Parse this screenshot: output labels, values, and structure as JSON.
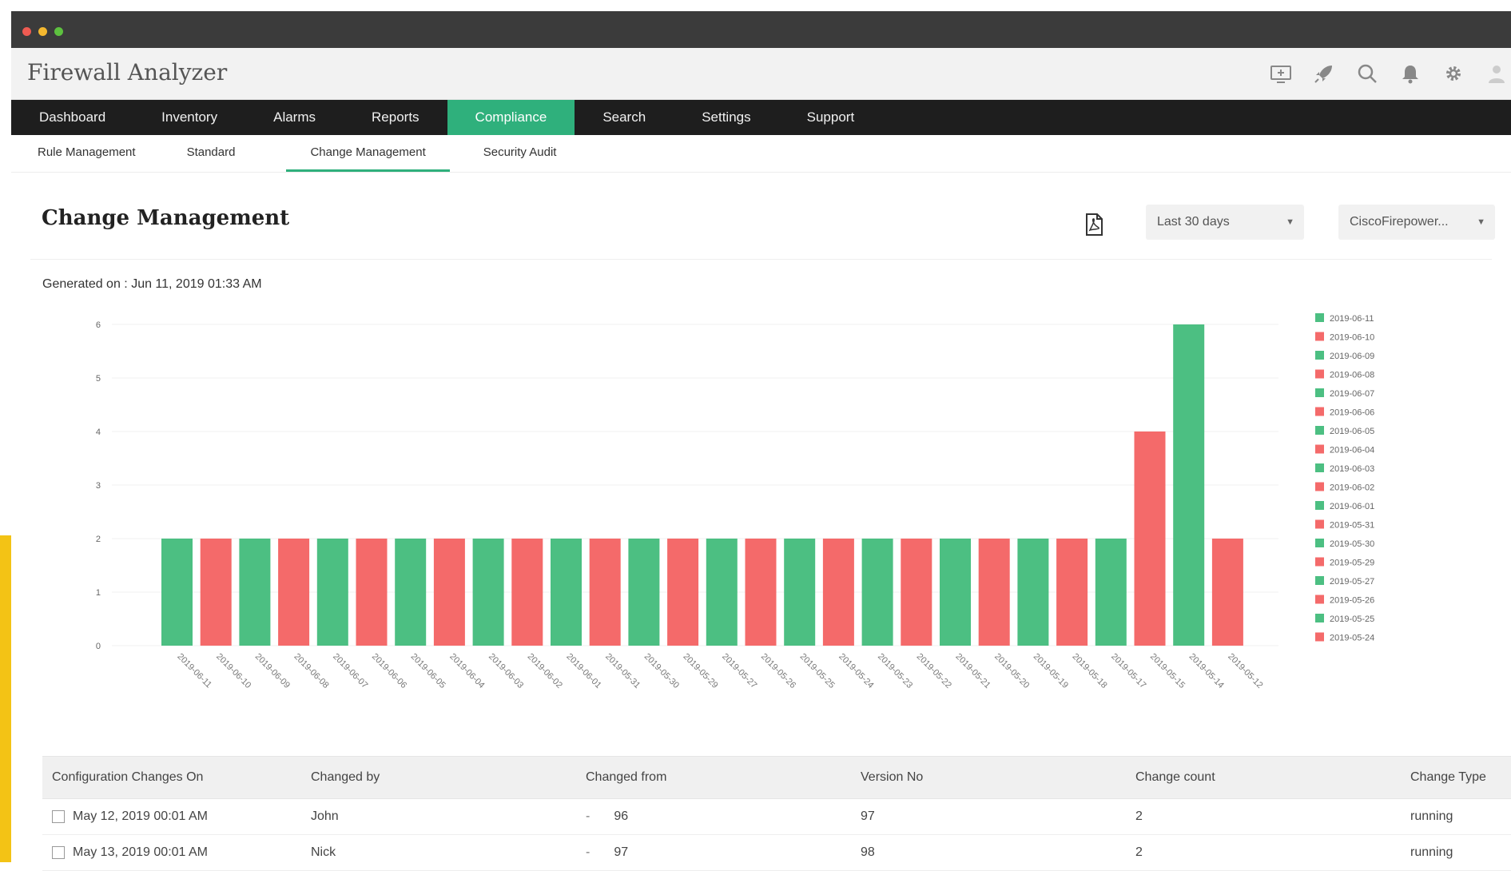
{
  "app": {
    "title": "Firewall Analyzer"
  },
  "header_icons": [
    "monitor-icon",
    "rocket-icon",
    "search-icon",
    "bell-icon",
    "gear-icon",
    "user-icon"
  ],
  "main_nav": [
    {
      "label": "Dashboard",
      "active": false
    },
    {
      "label": "Inventory",
      "active": false
    },
    {
      "label": "Alarms",
      "active": false
    },
    {
      "label": "Reports",
      "active": false
    },
    {
      "label": "Compliance",
      "active": true
    },
    {
      "label": "Search",
      "active": false
    },
    {
      "label": "Settings",
      "active": false
    },
    {
      "label": "Support",
      "active": false
    }
  ],
  "sub_nav": [
    {
      "label": "Rule Management",
      "active": false
    },
    {
      "label": "Standard",
      "active": false
    },
    {
      "label": "Change Management",
      "active": true
    },
    {
      "label": "Security Audit",
      "active": false
    }
  ],
  "page": {
    "title": "Change Management",
    "range_select": "Last 30 days",
    "device_select": "CiscoFirepower...",
    "generated": "Generated on : Jun 11, 2019 01:33 AM"
  },
  "colors": {
    "green": "#4cbf82",
    "red": "#f46a6a",
    "accent": "#2fb07c"
  },
  "chart_data": {
    "type": "bar",
    "ylim": [
      0,
      6
    ],
    "yticks": [
      0,
      1,
      2,
      3,
      4,
      5,
      6
    ],
    "categories": [
      "2019-06-11",
      "2019-06-10",
      "2019-06-09",
      "2019-06-08",
      "2019-06-07",
      "2019-06-06",
      "2019-06-05",
      "2019-06-04",
      "2019-06-03",
      "2019-06-02",
      "2019-06-01",
      "2019-05-31",
      "2019-05-30",
      "2019-05-29",
      "2019-05-27",
      "2019-05-26",
      "2019-05-25",
      "2019-05-24",
      "2019-05-23",
      "2019-05-22",
      "2019-05-21",
      "2019-05-20",
      "2019-05-19",
      "2019-05-18",
      "2019-05-17",
      "2019-05-15",
      "2019-05-14",
      "2019-05-12"
    ],
    "values": [
      2,
      2,
      2,
      2,
      2,
      2,
      2,
      2,
      2,
      2,
      2,
      2,
      2,
      2,
      2,
      2,
      2,
      2,
      2,
      2,
      2,
      2,
      2,
      2,
      2,
      4,
      6,
      2
    ],
    "bar_colors": [
      "green",
      "red",
      "green",
      "red",
      "green",
      "red",
      "green",
      "red",
      "green",
      "red",
      "green",
      "red",
      "green",
      "red",
      "green",
      "red",
      "green",
      "red",
      "green",
      "red",
      "green",
      "red",
      "green",
      "red",
      "green",
      "red",
      "green",
      "red"
    ],
    "legend": [
      {
        "label": "2019-06-11",
        "color": "green"
      },
      {
        "label": "2019-06-10",
        "color": "red"
      },
      {
        "label": "2019-06-09",
        "color": "green"
      },
      {
        "label": "2019-06-08",
        "color": "red"
      },
      {
        "label": "2019-06-07",
        "color": "green"
      },
      {
        "label": "2019-06-06",
        "color": "red"
      },
      {
        "label": "2019-06-05",
        "color": "green"
      },
      {
        "label": "2019-06-04",
        "color": "red"
      },
      {
        "label": "2019-06-03",
        "color": "green"
      },
      {
        "label": "2019-06-02",
        "color": "red"
      },
      {
        "label": "2019-06-01",
        "color": "green"
      },
      {
        "label": "2019-05-31",
        "color": "red"
      },
      {
        "label": "2019-05-30",
        "color": "green"
      },
      {
        "label": "2019-05-29",
        "color": "red"
      },
      {
        "label": "2019-05-27",
        "color": "green"
      },
      {
        "label": "2019-05-26",
        "color": "red"
      },
      {
        "label": "2019-05-25",
        "color": "green"
      },
      {
        "label": "2019-05-24",
        "color": "red"
      }
    ],
    "legend_position": "right",
    "grid": true
  },
  "table": {
    "columns": [
      "Configuration Changes On",
      "Changed by",
      "Changed from",
      "Version No",
      "Change count",
      "Change Type"
    ],
    "rows": [
      {
        "date": "May 12, 2019 00:01 AM",
        "changed_by": "John",
        "dash": "-",
        "changed_from": "96",
        "version": "97",
        "count": "2",
        "type": "running"
      },
      {
        "date": "May 13, 2019 00:01 AM",
        "changed_by": "Nick",
        "dash": "-",
        "changed_from": "97",
        "version": "98",
        "count": "2",
        "type": "running"
      }
    ]
  }
}
